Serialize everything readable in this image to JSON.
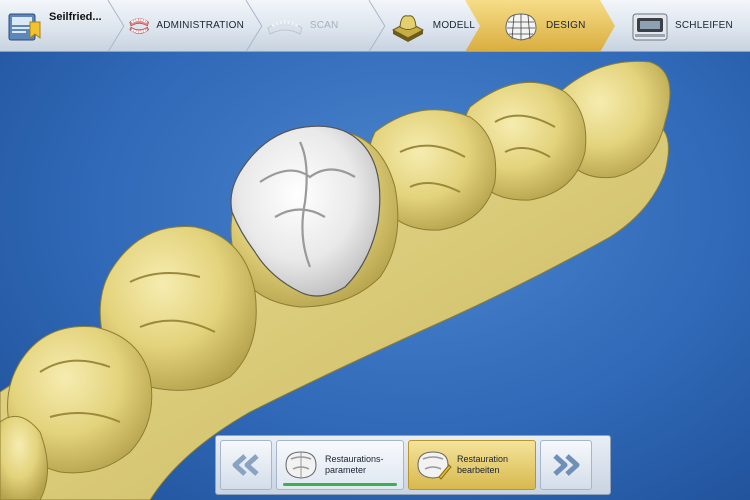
{
  "case": {
    "title": "Seilfried..."
  },
  "phases": [
    {
      "label": "ADMINISTRATION",
      "icon": "dentures-icon",
      "state": "normal"
    },
    {
      "label": "SCAN",
      "icon": "scan-jaw-icon",
      "state": "disabled"
    },
    {
      "label": "MODELL",
      "icon": "model-tooth-icon",
      "state": "normal"
    },
    {
      "label": "DESIGN",
      "icon": "design-crown-icon",
      "state": "active"
    },
    {
      "label": "SCHLEIFEN",
      "icon": "milling-machine-icon",
      "state": "normal"
    }
  ],
  "steps": [
    {
      "label": "Restaurations-\nparameter",
      "icon": "crown-parameter-icon",
      "state": "done"
    },
    {
      "label": "Restauration\nbearbeiten",
      "icon": "crown-edit-icon",
      "state": "active"
    }
  ],
  "colors": {
    "active_phase": "#e9c459",
    "viewport_bg": "#2f69b7",
    "tooth_model": "#e6d784",
    "restoration": "#eeeeee",
    "progress": "#37b34a"
  }
}
